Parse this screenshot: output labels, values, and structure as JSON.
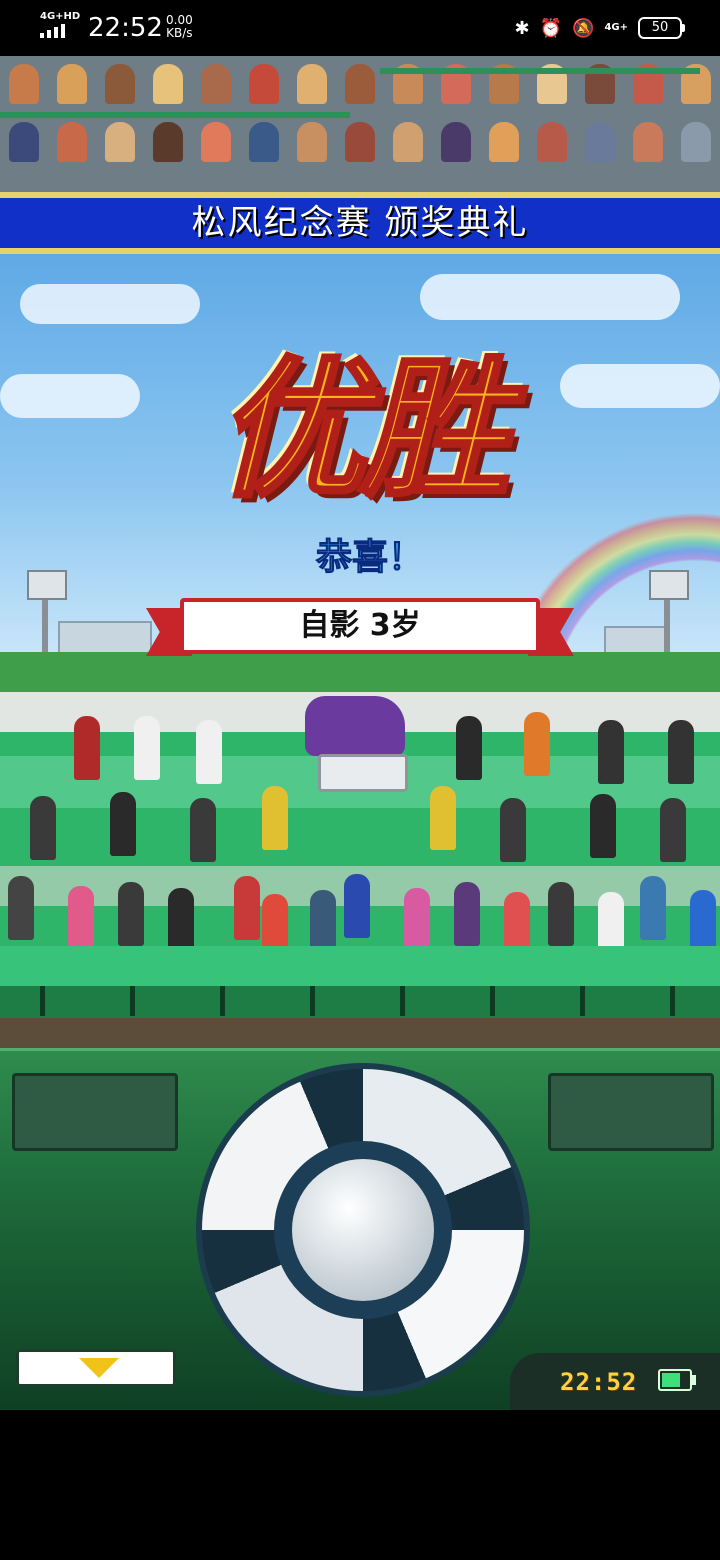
{
  "status_bar": {
    "network_left": "4G+HD",
    "time": "22:52",
    "speed_value": "0.00",
    "speed_unit": "KB/s",
    "network_right": "4G+",
    "battery": "50",
    "icons": [
      "bluetooth-icon",
      "alarm-icon",
      "mute-icon",
      "signal-icon",
      "battery-icon"
    ]
  },
  "game": {
    "ceremony_title": "松风纪念赛 颁奖典礼",
    "victory_text": "优胜",
    "congrats_text": "恭喜！",
    "winner_banner": "自影 3岁",
    "panel_clock": "22:52",
    "panel_battery_level": 0.7
  },
  "colors": {
    "title_band": "#1030c8",
    "gold_border": "#e9d16a",
    "victory_fill": "#ffb21a",
    "victory_stroke": "#b02018",
    "banner_red": "#c8252a",
    "grass": "#2fb56a",
    "panel_green": "#1d6a3a",
    "clock_yellow": "#ffd23d"
  }
}
